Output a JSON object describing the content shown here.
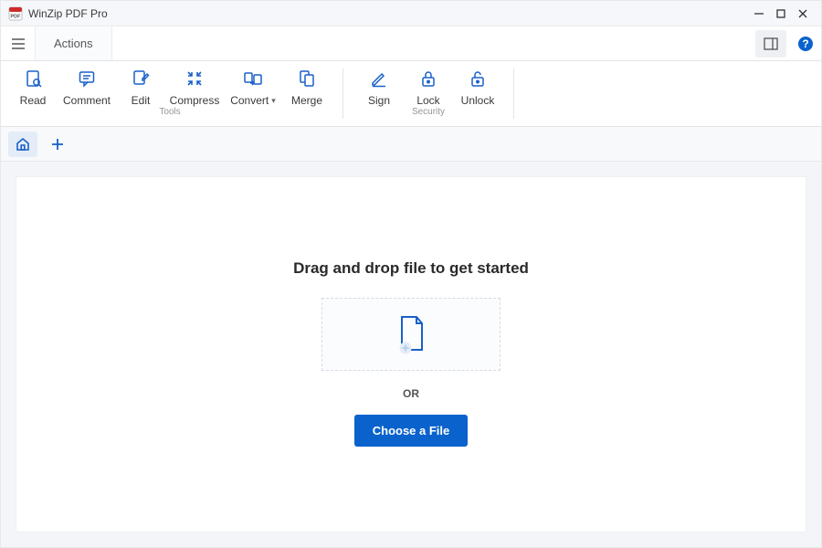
{
  "app": {
    "title": "WinZip PDF Pro"
  },
  "window_controls": {
    "min": "minimize",
    "max": "maximize",
    "close": "close"
  },
  "menubar": {
    "hamburger": "menu",
    "tab_actions": "Actions",
    "panel_icon": "panel",
    "help_icon": "help"
  },
  "ribbon": {
    "tools_group_label": "Tools",
    "security_group_label": "Security",
    "read": "Read",
    "comment": "Comment",
    "edit": "Edit",
    "compress": "Compress",
    "convert": "Convert",
    "merge": "Merge",
    "sign": "Sign",
    "lock": "Lock",
    "unlock": "Unlock"
  },
  "docstrip": {
    "home_icon": "home",
    "add_icon": "add"
  },
  "main": {
    "headline": "Drag and drop file to get started",
    "or": "OR",
    "choose": "Choose a File"
  },
  "colors": {
    "accent": "#0a62cc",
    "icon": "#1a60c9"
  }
}
